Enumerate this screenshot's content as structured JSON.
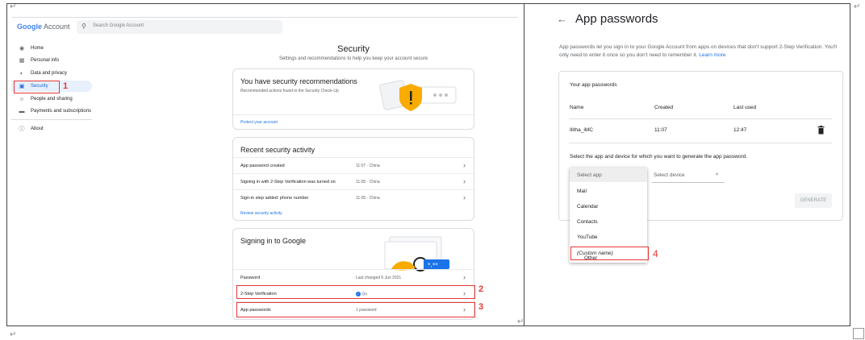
{
  "left": {
    "brand": {
      "google": "Google",
      "account": "Account"
    },
    "search_placeholder": "Search Google Account",
    "nav": [
      {
        "label": "Home",
        "icon": "home-icon"
      },
      {
        "label": "Personal info",
        "icon": "id-card-icon"
      },
      {
        "label": "Data and privacy",
        "icon": "toggle-icon"
      },
      {
        "label": "Security",
        "icon": "lock-icon"
      },
      {
        "label": "People and sharing",
        "icon": "people-icon"
      },
      {
        "label": "Payments and subscriptions",
        "icon": "card-icon"
      },
      {
        "label": "About",
        "icon": "info-icon"
      }
    ],
    "callouts": {
      "n1": "1",
      "n2": "2",
      "n3": "3"
    },
    "title": "Security",
    "subtitle": "Settings and recommendations to help you keep your account secure",
    "recommend": {
      "title": "You have security recommendations",
      "desc": "Recommended actions found in the Security Check-Up",
      "link": "Protect your account"
    },
    "activity": {
      "title": "Recent security activity",
      "rows": [
        {
          "label": "App password created",
          "meta": "11:07 · China"
        },
        {
          "label": "Signing in with 2-Step Verification was turned on",
          "meta": "11:05 · China"
        },
        {
          "label": "Sign-in step added: phone number",
          "meta": "11:05 · China"
        }
      ],
      "link": "Review security activity"
    },
    "signin": {
      "title": "Signing in to Google",
      "rows": [
        {
          "label": "Password",
          "meta": "Last changed 6 Jun 2021"
        },
        {
          "label": "2-Step Verification",
          "meta": "On"
        },
        {
          "label": "App passwords",
          "meta": "1 password"
        }
      ]
    }
  },
  "right": {
    "title": "App passwords",
    "desc": "App passwords let you sign in to your Google Account from apps on devices that don't support 2-Step Verification. You'll only need to enter it once so you don't need to remember it.",
    "learn_more": "Learn more",
    "card_title": "Your app passwords",
    "headers": {
      "name": "Name",
      "created": "Created",
      "last_used": "Last used"
    },
    "entry": {
      "name": "Ilitha_iMC",
      "created": "11:07",
      "last_used": "12:47"
    },
    "select_prompt": "Select the app and device for which you want to generate the app password.",
    "select_device": "Select device",
    "dropdown": [
      "Select app",
      "Mail",
      "Calendar",
      "Contacts",
      "YouTube"
    ],
    "other_label": "Other",
    "other_hint": "(Custom name)",
    "callout4": "4",
    "generate": "GENERATE"
  },
  "colors": {
    "accent": "#1a73e8",
    "callout": "#e53935",
    "shield": "#f9ab00"
  }
}
